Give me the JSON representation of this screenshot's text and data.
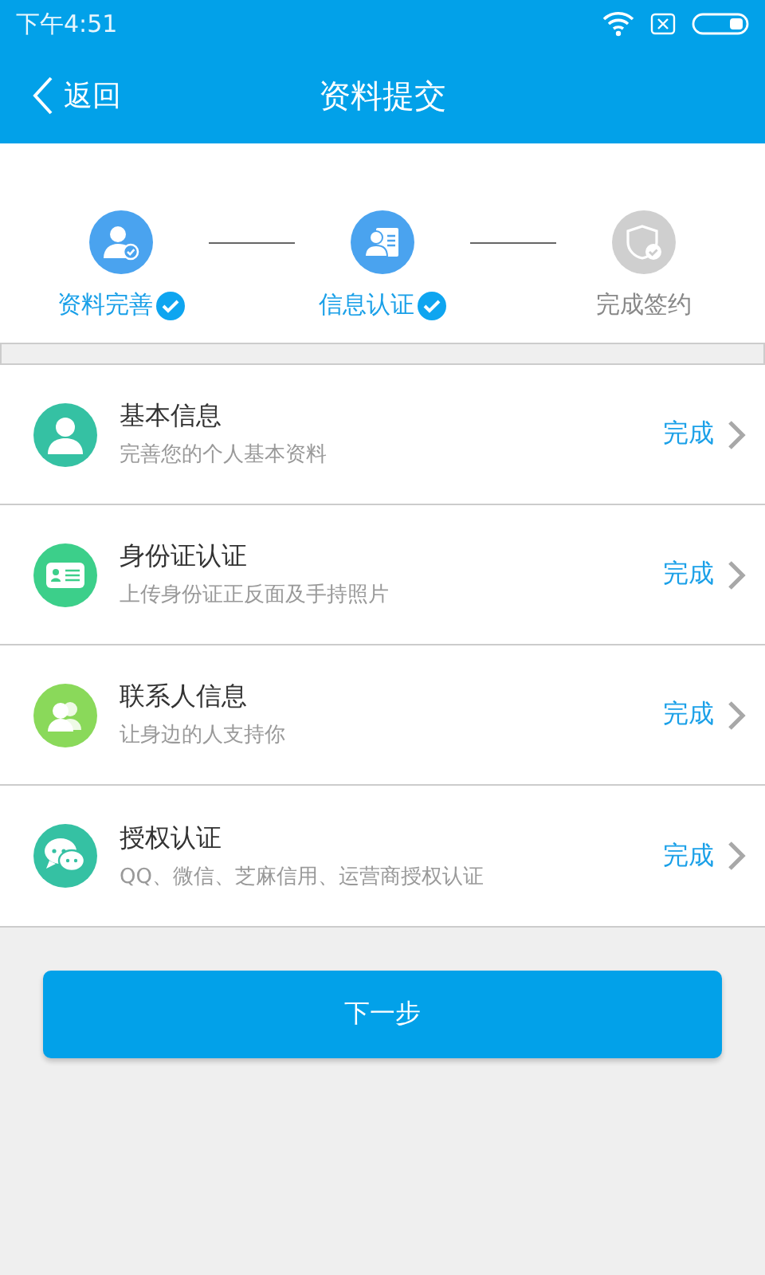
{
  "status_bar": {
    "time": "下午4:51"
  },
  "header": {
    "back": "返回",
    "title": "资料提交"
  },
  "steps": [
    {
      "label": "资料完善",
      "done": true,
      "kind": "profile"
    },
    {
      "label": "信息认证",
      "done": true,
      "kind": "card"
    },
    {
      "label": "完成签约",
      "done": false,
      "kind": "shield"
    }
  ],
  "items": [
    {
      "title": "基本信息",
      "subtitle": "完善您的个人基本资料",
      "status": "完成",
      "kind": "person",
      "color": "#35c1a3"
    },
    {
      "title": "身份证认证",
      "subtitle": "上传身份证正反面及手持照片",
      "status": "完成",
      "kind": "idcard",
      "color": "#3ccf8a"
    },
    {
      "title": "联系人信息",
      "subtitle": "让身边的人支持你",
      "status": "完成",
      "kind": "contacts",
      "color": "#8ad95a"
    },
    {
      "title": "授权认证",
      "subtitle": "QQ、微信、芝麻信用、运营商授权认证",
      "status": "完成",
      "kind": "chat",
      "color": "#35c1a3"
    }
  ],
  "next_button": "下一步"
}
